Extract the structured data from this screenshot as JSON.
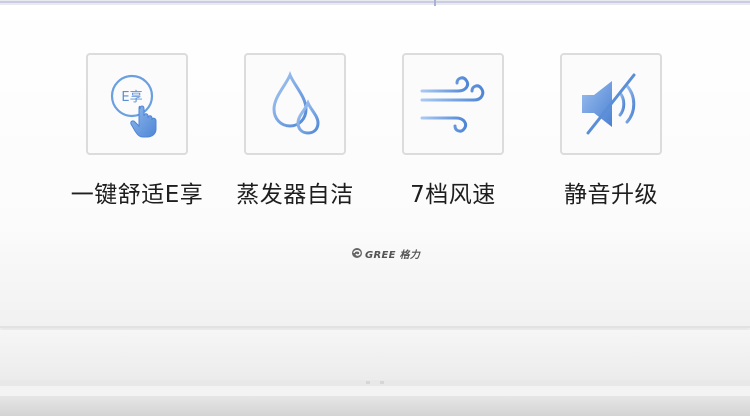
{
  "features": [
    {
      "icon": "one-touch-e-comfort-icon",
      "icon_text": "E享",
      "label": "一键舒适E享"
    },
    {
      "icon": "water-drops-icon",
      "label": "蒸发器自洁"
    },
    {
      "icon": "wind-icon",
      "label": "7档风速"
    },
    {
      "icon": "speaker-mute-icon",
      "label": "静音升级"
    }
  ],
  "brand": {
    "logo_text": "GREE 格力"
  },
  "colors": {
    "icon_blue": "#6a9fe0",
    "icon_light": "#b8d3f5",
    "label_text": "#1e1e1e",
    "box_border": "#dcdcdc"
  }
}
